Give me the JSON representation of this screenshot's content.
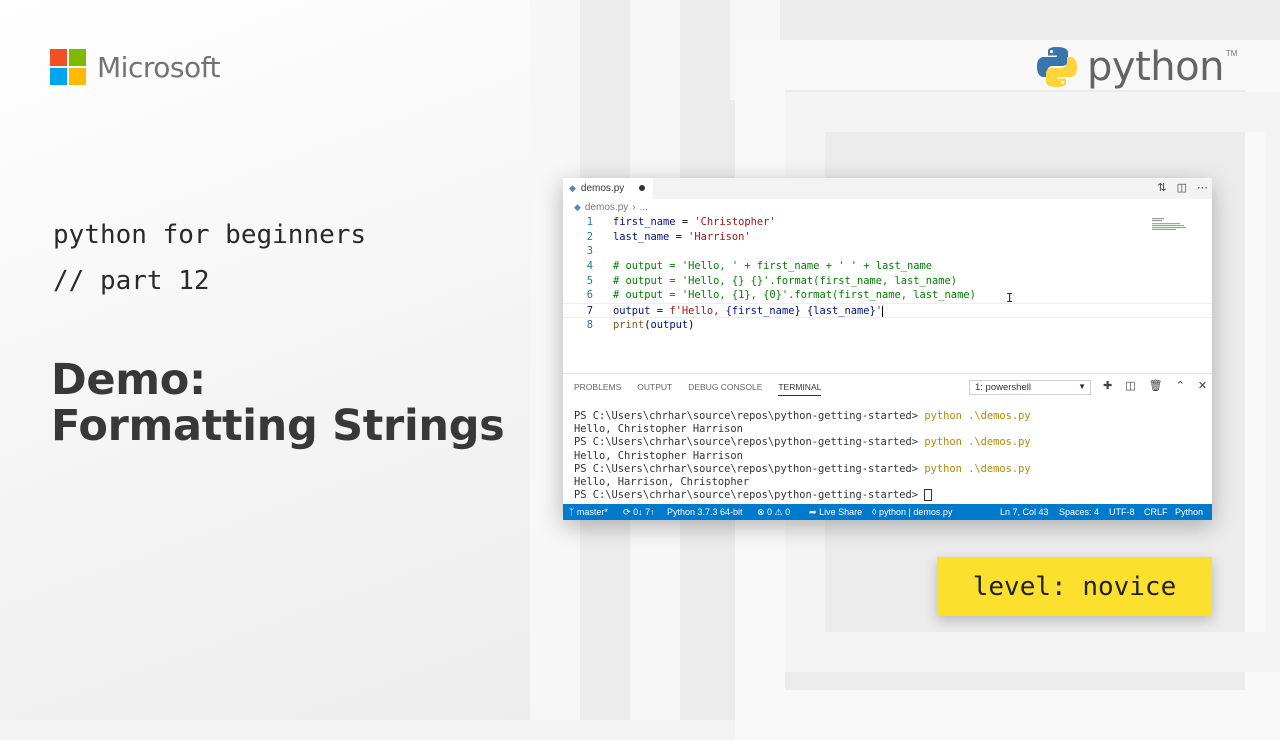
{
  "brand": {
    "microsoft_text": "Microsoft",
    "microsoft_colors": [
      "#f25022",
      "#7fba00",
      "#00a4ef",
      "#ffb900"
    ],
    "python_text": "python",
    "python_tm": "TM",
    "python_colors": [
      "#3776ab",
      "#ffd43b"
    ]
  },
  "titles": {
    "line1": "python for beginners",
    "line2": "// part 12",
    "demo_line1": "Demo:",
    "demo_line2": "Formatting Strings"
  },
  "editor": {
    "tab_label": "demos.py",
    "breadcrumb_file": "demos.py",
    "breadcrumb_more": "...",
    "code_lines": [
      {
        "n": "1",
        "text": "first_name = 'Christopher'"
      },
      {
        "n": "2",
        "text": "last_name = 'Harrison'"
      },
      {
        "n": "3",
        "text": ""
      },
      {
        "n": "4",
        "text": "# output = 'Hello, ' + first_name + ' ' + last_name"
      },
      {
        "n": "5",
        "text": "# output = 'Hello, {} {}'.format(first_name, last_name)"
      },
      {
        "n": "6",
        "text": "# output = 'Hello, {1}, {0}'.format(first_name, last_name)"
      },
      {
        "n": "7",
        "text": "output = f'Hello, {first_name} {last_name}'"
      },
      {
        "n": "8",
        "text": "print(output)"
      }
    ]
  },
  "panel": {
    "tabs": [
      "PROBLEMS",
      "OUTPUT",
      "DEBUG CONSOLE",
      "TERMINAL"
    ],
    "active_tab": "TERMINAL",
    "terminal_select": "1: powershell",
    "terminal_lines": [
      {
        "prompt": "PS C:\\Users\\chrhar\\source\\repos\\python-getting-started> ",
        "cmd": "python .\\demos.py"
      },
      {
        "prompt": "Hello, Christopher Harrison",
        "cmd": ""
      },
      {
        "prompt": "PS C:\\Users\\chrhar\\source\\repos\\python-getting-started> ",
        "cmd": "python .\\demos.py"
      },
      {
        "prompt": "Hello, Christopher Harrison",
        "cmd": ""
      },
      {
        "prompt": "PS C:\\Users\\chrhar\\source\\repos\\python-getting-started> ",
        "cmd": "python .\\demos.py"
      },
      {
        "prompt": "Hello, Harrison, Christopher",
        "cmd": ""
      }
    ],
    "final_prompt": "PS C:\\Users\\chrhar\\source\\repos\\python-getting-started> "
  },
  "statusbar": {
    "branch": "master*",
    "sync": "0↓ 7↑",
    "interpreter": "Python 3.7.3 64-bit",
    "problems": "⊗ 0 ⚠ 0",
    "live_share": "Live Share",
    "context": "python | demos.py",
    "position": "Ln 7, Col 43",
    "spaces": "Spaces: 4",
    "encoding": "UTF-8",
    "eol": "CRLF",
    "language": "Python",
    "bg_color": "#007acc"
  },
  "badge": {
    "text": "level: novice",
    "color": "#fbe12d"
  }
}
